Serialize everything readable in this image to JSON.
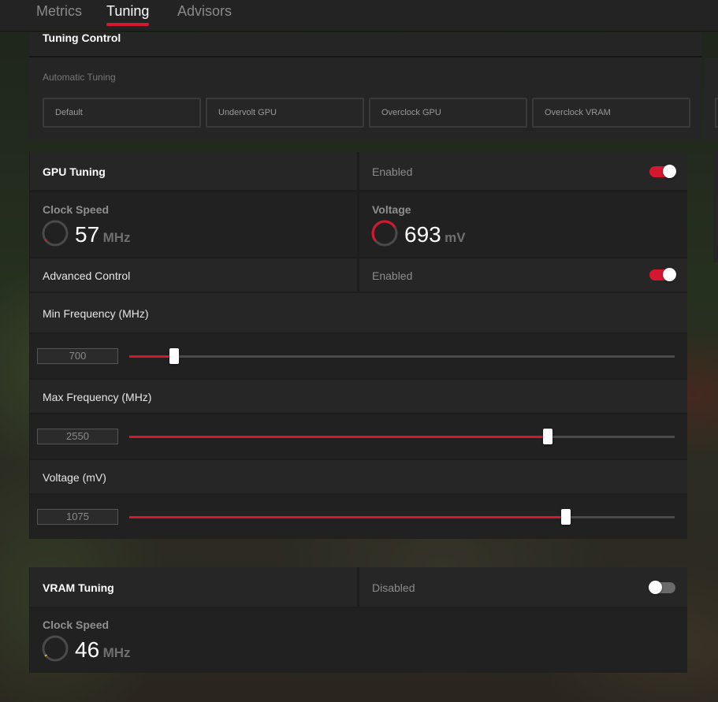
{
  "tabs": [
    {
      "label": "Metrics",
      "active": false
    },
    {
      "label": "Tuning",
      "active": true
    },
    {
      "label": "Advisors",
      "active": false
    }
  ],
  "accent_color": "#d5172f",
  "tuning_control": {
    "title": "Tuning Control",
    "automatic_label": "Automatic Tuning",
    "presets": [
      "Default",
      "Undervolt GPU",
      "Overclock GPU",
      "Overclock VRAM"
    ]
  },
  "gpu_tuning": {
    "title": "GPU Tuning",
    "status": "Enabled",
    "enabled": true,
    "clock_speed": {
      "label": "Clock Speed",
      "value": "57",
      "unit": "MHz"
    },
    "voltage": {
      "label": "Voltage",
      "value": "693",
      "unit": "mV"
    },
    "advanced_control": {
      "label": "Advanced Control",
      "status": "Enabled",
      "enabled": true
    },
    "min_frequency": {
      "label": "Min Frequency (MHz)",
      "value": "700",
      "slider_fraction": 0.082
    },
    "max_frequency": {
      "label": "Max Frequency (MHz)",
      "value": "2550",
      "slider_fraction": 0.768
    },
    "voltage_slider": {
      "label": "Voltage (mV)",
      "value": "1075",
      "slider_fraction": 0.8
    }
  },
  "vram_tuning": {
    "title": "VRAM Tuning",
    "status": "Disabled",
    "enabled": false,
    "clock_speed": {
      "label": "Clock Speed",
      "value": "46",
      "unit": "MHz"
    }
  }
}
